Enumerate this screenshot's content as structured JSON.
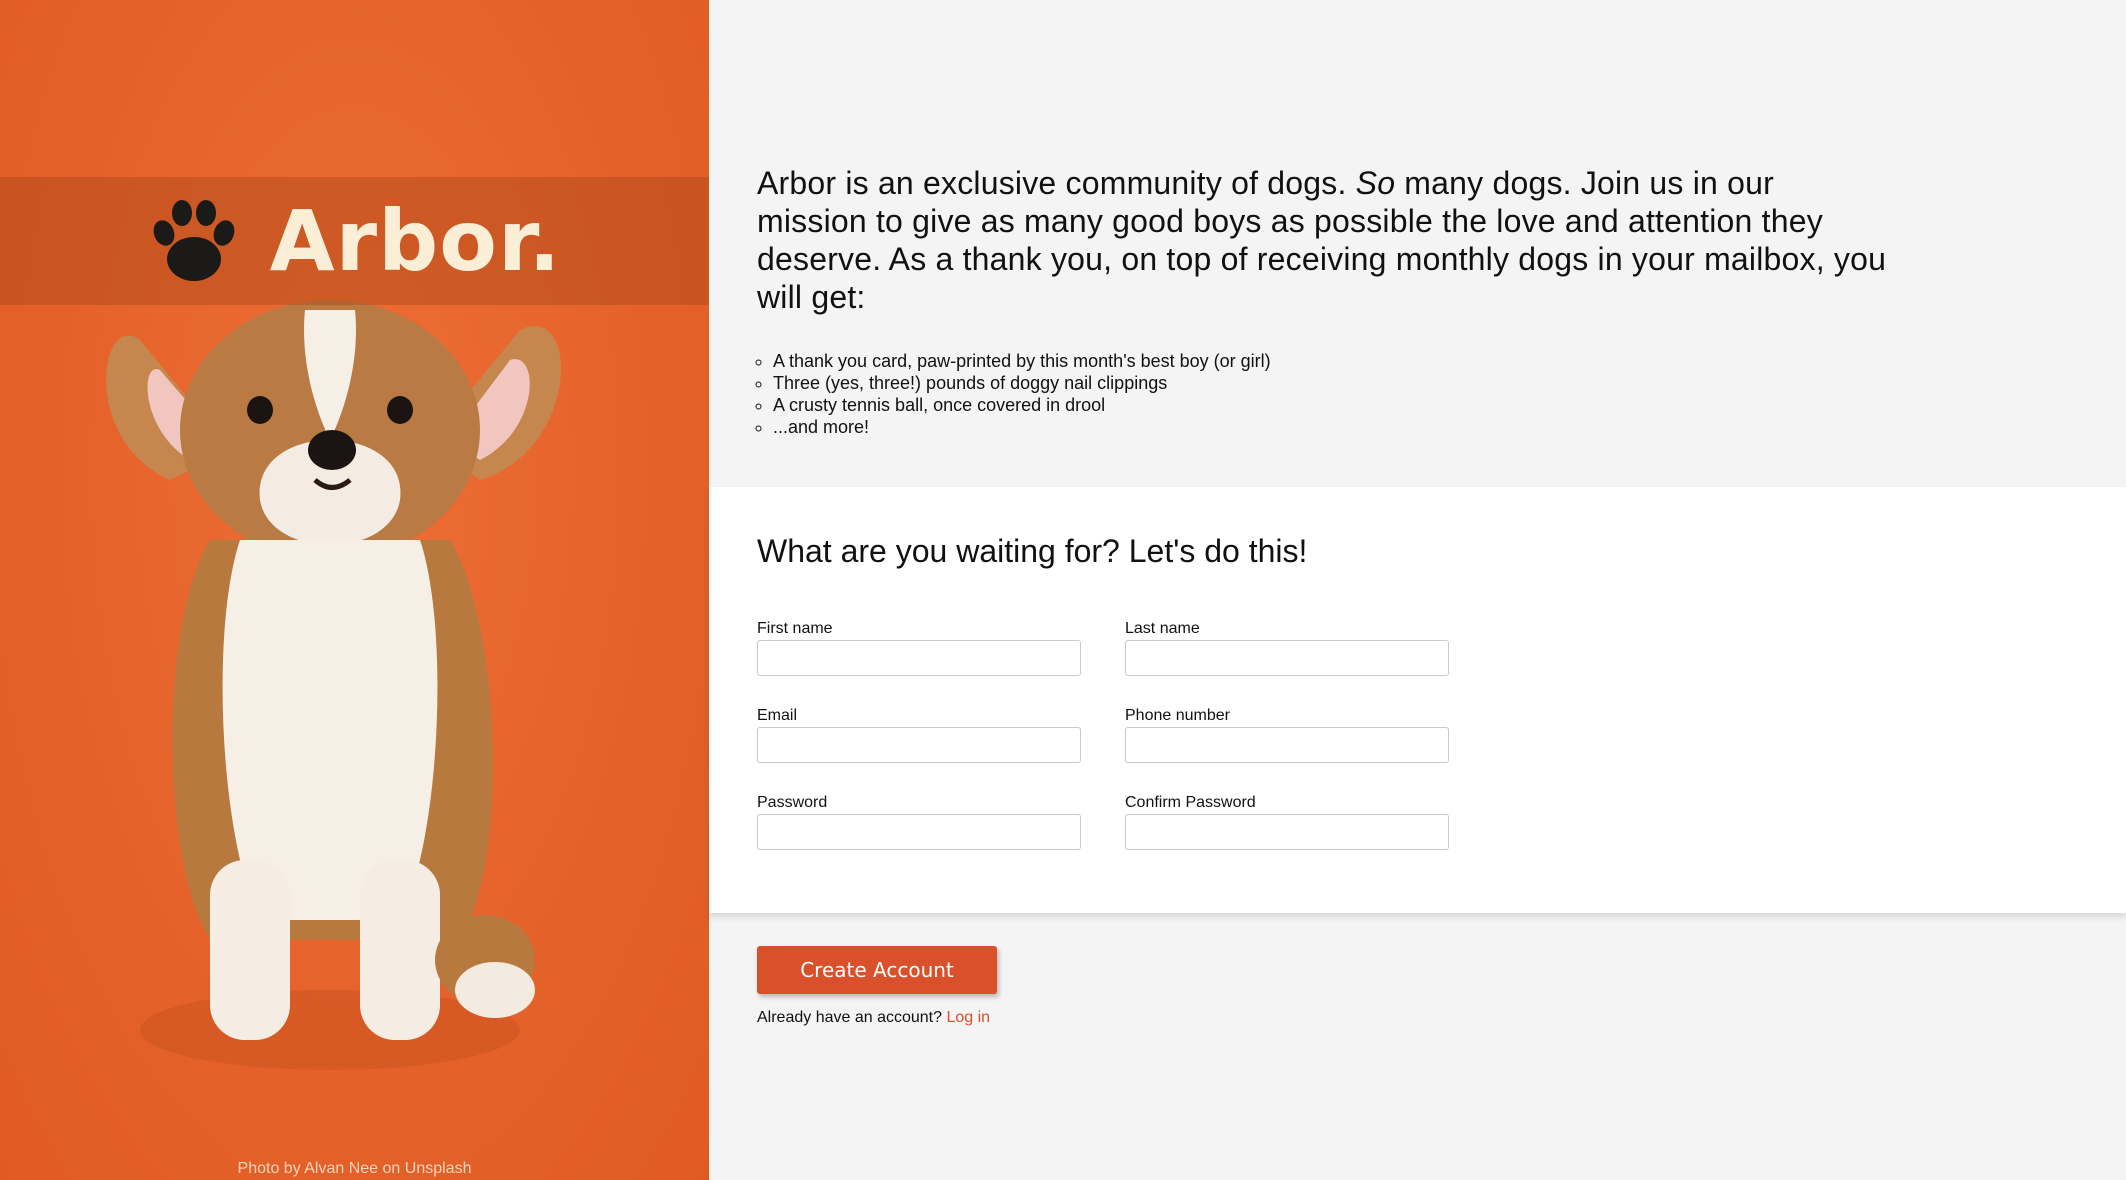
{
  "brand": {
    "name": "Arbor.",
    "photo_credit": "Photo by Alvan Nee on Unsplash",
    "accent_color": "#d9502a",
    "icon": "paw-icon"
  },
  "intro": {
    "before_emphasis": "Arbor is an exclusive community of dogs. ",
    "emphasis": "So",
    "after_emphasis": " many dogs. Join us in our mission to give as many good boys as possible the love and attention they deserve. As a thank you, on top of receiving monthly dogs in your mailbox, you will get:"
  },
  "perks": [
    "A thank you card, paw-printed by this month's best boy (or girl)",
    "Three (yes, three!) pounds of doggy nail clippings",
    "A crusty tennis ball, once covered in drool",
    "...and more!"
  ],
  "form": {
    "title": "What are you waiting for? Let's do this!",
    "first_name": {
      "label": "First name",
      "value": ""
    },
    "last_name": {
      "label": "Last name",
      "value": ""
    },
    "email": {
      "label": "Email",
      "value": ""
    },
    "phone": {
      "label": "Phone number",
      "value": ""
    },
    "password": {
      "label": "Password",
      "value": ""
    },
    "confirm_password": {
      "label": "Confirm Password",
      "value": ""
    }
  },
  "actions": {
    "create_account": "Create Account",
    "login_prompt": "Already have an account?",
    "login_link": "Log in"
  }
}
